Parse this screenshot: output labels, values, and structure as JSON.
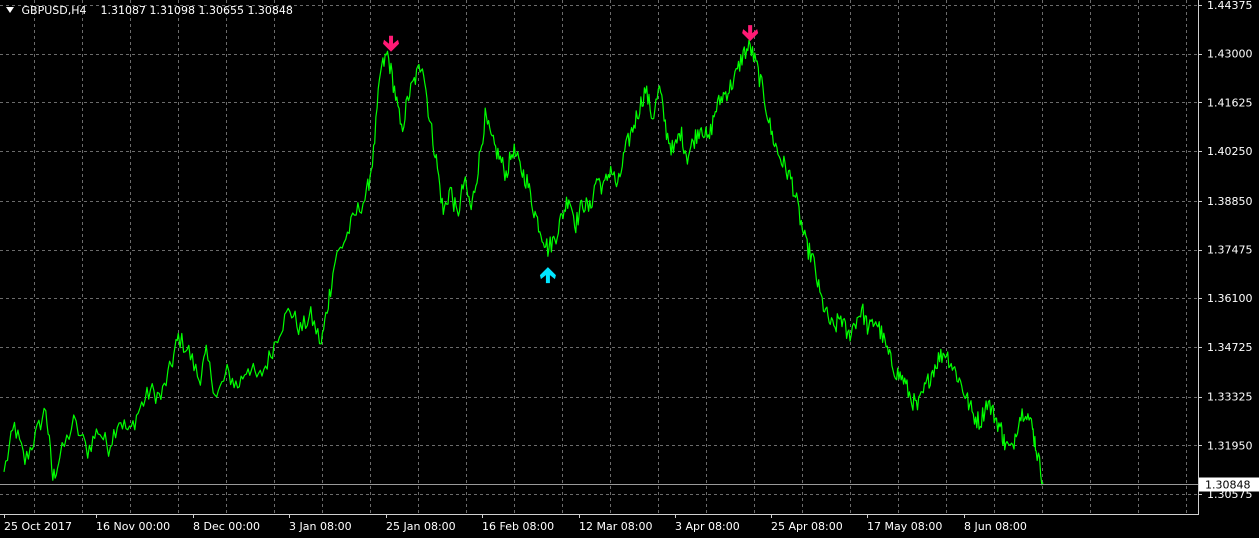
{
  "header": {
    "symbol": "GBPUSD,H4",
    "ohlc": "1.31087 1.31098 1.30655 1.30848"
  },
  "colors": {
    "background": "#000000",
    "price_line": "#00ff00",
    "grid": "#6b6b6b",
    "axis_text": "#ffffff",
    "sell_arrow": "#ff1a75",
    "buy_arrow": "#00e5ff"
  },
  "chart_data": {
    "type": "line",
    "title": "",
    "grid": true,
    "y_axis_side": "right",
    "ylim": [
      1.30575,
      1.44375
    ],
    "y_ticks": [
      "1.44375",
      "1.43000",
      "1.41625",
      "1.40250",
      "1.38850",
      "1.37475",
      "1.36100",
      "1.34725",
      "1.33325",
      "1.31950",
      "1.30575"
    ],
    "x_ticks": [
      "25 Oct 2017",
      "16 Nov 00:00",
      "8 Dec 00:00",
      "3 Jan 08:00",
      "25 Jan 08:00",
      "16 Feb 08:00",
      "12 Mar 08:00",
      "3 Apr 08:00",
      "25 Apr 08:00",
      "17 May 08:00",
      "8 Jun 08:00"
    ],
    "current_price": "1.30848",
    "series": [
      {
        "values": [
          [
            0,
            1.312
          ],
          [
            3,
            1.325
          ],
          [
            6,
            1.315
          ],
          [
            9,
            1.322
          ],
          [
            12,
            1.33
          ],
          [
            14,
            1.31
          ],
          [
            16,
            1.316
          ],
          [
            20,
            1.326
          ],
          [
            24,
            1.318
          ],
          [
            27,
            1.324
          ],
          [
            30,
            1.319
          ],
          [
            33,
            1.327
          ],
          [
            36,
            1.323
          ],
          [
            39,
            1.33
          ],
          [
            42,
            1.335
          ],
          [
            45,
            1.333
          ],
          [
            48,
            1.342
          ],
          [
            50,
            1.35
          ],
          [
            53,
            1.346
          ],
          [
            56,
            1.338
          ],
          [
            58,
            1.345
          ],
          [
            61,
            1.333
          ],
          [
            64,
            1.34
          ],
          [
            67,
            1.336
          ],
          [
            70,
            1.342
          ],
          [
            73,
            1.338
          ],
          [
            76,
            1.344
          ],
          [
            79,
            1.352
          ],
          [
            82,
            1.358
          ],
          [
            85,
            1.352
          ],
          [
            88,
            1.356
          ],
          [
            91,
            1.348
          ],
          [
            93,
            1.36
          ],
          [
            95,
            1.372
          ],
          [
            98,
            1.378
          ],
          [
            101,
            1.385
          ],
          [
            104,
            1.39
          ],
          [
            106,
            1.402
          ],
          [
            108,
            1.425
          ],
          [
            110,
            1.43
          ],
          [
            112,
            1.42
          ],
          [
            114,
            1.408
          ],
          [
            116,
            1.418
          ],
          [
            118,
            1.423
          ],
          [
            120,
            1.428
          ],
          [
            122,
            1.412
          ],
          [
            124,
            1.4
          ],
          [
            126,
            1.385
          ],
          [
            128,
            1.392
          ],
          [
            130,
            1.384
          ],
          [
            132,
            1.394
          ],
          [
            134,
            1.386
          ],
          [
            136,
            1.398
          ],
          [
            138,
            1.412
          ],
          [
            140,
            1.405
          ],
          [
            142,
            1.401
          ],
          [
            144,
            1.396
          ],
          [
            146,
            1.403
          ],
          [
            148,
            1.398
          ],
          [
            150,
            1.394
          ],
          [
            152,
            1.386
          ],
          [
            154,
            1.38
          ],
          [
            156,
            1.375
          ],
          [
            158,
            1.378
          ],
          [
            160,
            1.384
          ],
          [
            162,
            1.39
          ],
          [
            164,
            1.382
          ],
          [
            166,
            1.388
          ],
          [
            168,
            1.386
          ],
          [
            170,
            1.395
          ],
          [
            172,
            1.392
          ],
          [
            174,
            1.398
          ],
          [
            176,
            1.392
          ],
          [
            178,
            1.402
          ],
          [
            180,
            1.408
          ],
          [
            182,
            1.414
          ],
          [
            184,
            1.42
          ],
          [
            186,
            1.412
          ],
          [
            188,
            1.42
          ],
          [
            190,
            1.408
          ],
          [
            192,
            1.402
          ],
          [
            194,
            1.408
          ],
          [
            196,
            1.401
          ],
          [
            198,
            1.406
          ],
          [
            200,
            1.41
          ],
          [
            202,
            1.405
          ],
          [
            204,
            1.414
          ],
          [
            206,
            1.418
          ],
          [
            208,
            1.42
          ],
          [
            210,
            1.424
          ],
          [
            212,
            1.43
          ],
          [
            214,
            1.432
          ],
          [
            216,
            1.426
          ],
          [
            218,
            1.418
          ],
          [
            220,
            1.408
          ],
          [
            222,
            1.402
          ],
          [
            224,
            1.398
          ],
          [
            226,
            1.394
          ],
          [
            228,
            1.385
          ],
          [
            230,
            1.376
          ],
          [
            232,
            1.372
          ],
          [
            234,
            1.362
          ],
          [
            236,
            1.356
          ],
          [
            238,
            1.352
          ],
          [
            240,
            1.356
          ],
          [
            242,
            1.35
          ],
          [
            244,
            1.354
          ],
          [
            246,
            1.358
          ],
          [
            248,
            1.352
          ],
          [
            250,
            1.355
          ],
          [
            252,
            1.35
          ],
          [
            254,
            1.344
          ],
          [
            256,
            1.34
          ],
          [
            258,
            1.338
          ],
          [
            260,
            1.333
          ],
          [
            262,
            1.33
          ],
          [
            264,
            1.335
          ],
          [
            266,
            1.34
          ],
          [
            268,
            1.344
          ],
          [
            270,
            1.346
          ],
          [
            272,
            1.342
          ],
          [
            274,
            1.338
          ],
          [
            276,
            1.333
          ],
          [
            278,
            1.328
          ],
          [
            280,
            1.326
          ],
          [
            282,
            1.332
          ],
          [
            284,
            1.328
          ],
          [
            286,
            1.324
          ],
          [
            287,
            1.32
          ],
          [
            289,
            1.318
          ],
          [
            291,
            1.327
          ],
          [
            293,
            1.33
          ],
          [
            295,
            1.324
          ],
          [
            296,
            1.319
          ],
          [
            298,
            1.309
          ]
        ]
      }
    ],
    "signals": [
      {
        "type": "sell",
        "x": 111,
        "price": 1.4345
      },
      {
        "type": "buy",
        "x": 156,
        "price": 1.3692
      },
      {
        "type": "sell",
        "x": 214,
        "price": 1.4375
      }
    ],
    "x_domain": [
      0,
      300
    ]
  }
}
